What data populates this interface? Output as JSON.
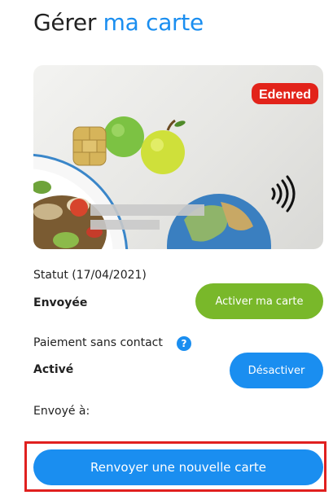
{
  "header": {
    "title_part1": "Gérer",
    "title_part2": "ma carte"
  },
  "card": {
    "brand": "Edenred",
    "colors": {
      "brand_red": "#e2231a",
      "chip_gold": "#d6b45a",
      "apple_green": "#7cc243",
      "apple_yellow": "#cfe03a"
    },
    "icons": [
      "chip-icon",
      "contactless-icon",
      "globe-icon",
      "apple-icon",
      "salad-icon"
    ]
  },
  "status": {
    "label": "Statut (17/04/2021)",
    "value": "Envoyée",
    "activate_label": "Activer ma carte"
  },
  "contactless": {
    "label": "Paiement sans contact",
    "help_icon": "?",
    "value": "Activé",
    "deactivate_label": "Désactiver"
  },
  "shipping": {
    "label": "Envoyé à:"
  },
  "actions": {
    "resend_label": "Renvoyer une nouvelle carte"
  },
  "colors": {
    "accent_blue": "#1a8ef0",
    "green": "#79b82a",
    "highlight_red": "#e0201f"
  }
}
